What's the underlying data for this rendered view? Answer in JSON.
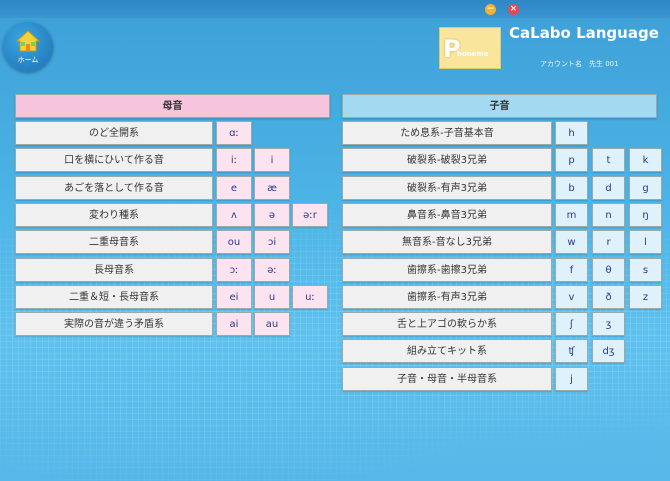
{
  "window": {
    "minimize": "−",
    "close": "×"
  },
  "home": {
    "label": "ホーム"
  },
  "logo": {
    "letter": "P",
    "text": "honeme"
  },
  "app": {
    "title": "CaLabo Language",
    "account": "アカウント名　先生 001"
  },
  "vowels": {
    "header": "母音",
    "rows": [
      {
        "label": "のど全開系",
        "symbols": [
          "ɑː"
        ]
      },
      {
        "label": "口を横にひいて作る音",
        "symbols": [
          "iː",
          "i"
        ]
      },
      {
        "label": "あごを落として作る音",
        "symbols": [
          "e",
          "æ"
        ]
      },
      {
        "label": "変わり種系",
        "symbols": [
          "ʌ",
          "ə",
          "əːr"
        ]
      },
      {
        "label": "二重母音系",
        "symbols": [
          "ou",
          "ɔi"
        ]
      },
      {
        "label": "長母音系",
        "symbols": [
          "ɔː",
          "əː"
        ]
      },
      {
        "label": "二重＆短・長母音系",
        "symbols": [
          "ei",
          "u",
          "uː"
        ]
      },
      {
        "label": "実際の音が違う矛盾系",
        "symbols": [
          "ai",
          "au"
        ]
      }
    ]
  },
  "consonants": {
    "header": "子音",
    "rows": [
      {
        "label": "ため息系-子音基本音",
        "symbols": [
          "h"
        ]
      },
      {
        "label": "破裂系-破裂3兄弟",
        "symbols": [
          "p",
          "t",
          "k"
        ]
      },
      {
        "label": "破裂系-有声3兄弟",
        "symbols": [
          "b",
          "d",
          "g"
        ]
      },
      {
        "label": "鼻音系-鼻音3兄弟",
        "symbols": [
          "m",
          "n",
          "ŋ"
        ]
      },
      {
        "label": "無音系-音なし3兄弟",
        "symbols": [
          "w",
          "r",
          "l"
        ]
      },
      {
        "label": "歯擦系-歯擦3兄弟",
        "symbols": [
          "f",
          "θ",
          "s"
        ]
      },
      {
        "label": "歯擦系-有声3兄弟",
        "symbols": [
          "v",
          "ð",
          "z"
        ]
      },
      {
        "label": "舌と上アゴの軟らか系",
        "symbols": [
          "ʃ",
          "ʒ"
        ]
      },
      {
        "label": "組み立てキット系",
        "symbols": [
          "ʧ",
          "dʒ"
        ]
      },
      {
        "label": "子音・母音・半母音系",
        "symbols": [
          "j"
        ]
      }
    ]
  },
  "colors": {
    "vowel_accent": "#f6c4dd",
    "consonant_accent": "#a4d9f2",
    "symbol_text": "#2a3a8c"
  }
}
